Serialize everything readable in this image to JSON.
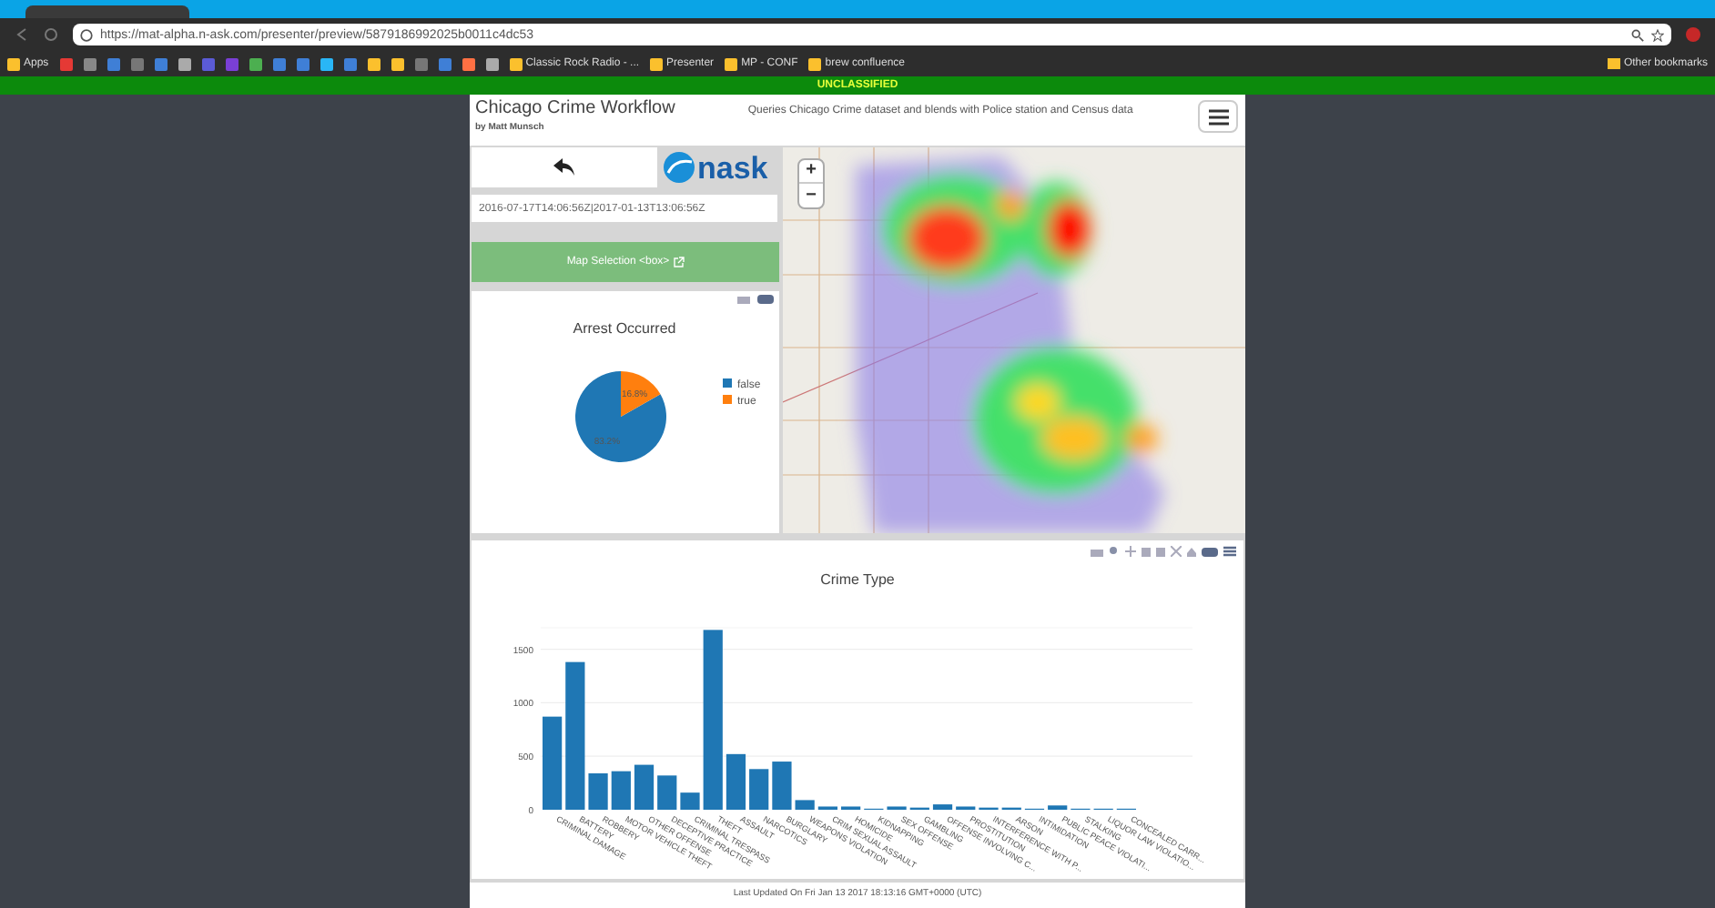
{
  "browser": {
    "url": "https://mat-alpha.n-ask.com/presenter/preview/5879186992025b0011c4dc53",
    "bookmarks": [
      {
        "label": "Apps"
      },
      {
        "label": "Classic Rock Radio - ..."
      },
      {
        "label": "Presenter"
      },
      {
        "label": "MP - CONF"
      },
      {
        "label": "brew confluence"
      }
    ],
    "other_bookmarks": "Other bookmarks"
  },
  "banner": "UNCLASSIFIED",
  "header": {
    "title": "Chicago Crime Workflow",
    "author": "by Matt Munsch",
    "description": "Queries Chicago Crime dataset and blends with Police station and Census data"
  },
  "logo": "nask",
  "date_range": {
    "value": "2016-07-17T14:06:56Z|2017-01-13T13:06:56Z"
  },
  "map_selection_button": "Map Selection <box>",
  "map": {
    "zoom_in": "+",
    "zoom_out": "−"
  },
  "arrest_chart": {
    "chart_data": {
      "type": "pie",
      "title": "Arrest Occurred",
      "categories": [
        "false",
        "true"
      ],
      "values": [
        83.2,
        16.8
      ],
      "value_labels": [
        "83.2%",
        "16.8%"
      ],
      "colors": [
        "#1f77b4",
        "#ff7f0e"
      ],
      "legend": "right"
    }
  },
  "crime_chart": {
    "chart_data": {
      "type": "bar",
      "title": "Crime Type",
      "categories": [
        "CRIMINAL DAMAGE",
        "BATTERY",
        "ROBBERY",
        "MOTOR VEHICLE THEFT",
        "OTHER OFFENSE",
        "DECEPTIVE PRACTICE",
        "CRIMINAL TRESPASS",
        "THEFT",
        "ASSAULT",
        "NARCOTICS",
        "BURGLARY",
        "WEAPONS VIOLATION",
        "CRIM SEXUAL ASSAULT",
        "HOMICIDE",
        "KIDNAPPING",
        "SEX OFFENSE",
        "GAMBLING",
        "OFFENSE INVOLVING C...",
        "PROSTITUTION",
        "INTERFERENCE WITH P...",
        "ARSON",
        "INTIMIDATION",
        "PUBLIC PEACE VIOLATI...",
        "STALKING",
        "LIQUOR LAW VIOLATIO...",
        "CONCEALED CARR..."
      ],
      "values": [
        870,
        1380,
        340,
        360,
        420,
        320,
        160,
        1680,
        520,
        380,
        450,
        90,
        30,
        30,
        10,
        30,
        20,
        50,
        30,
        20,
        20,
        10,
        40,
        10,
        10,
        10
      ],
      "ylim": [
        0,
        1700
      ],
      "yticks": [
        0,
        500,
        1000,
        1500
      ],
      "grid": true
    }
  },
  "footer": "Last Updated On Fri Jan 13 2017 18:13:16 GMT+0000 (UTC)"
}
